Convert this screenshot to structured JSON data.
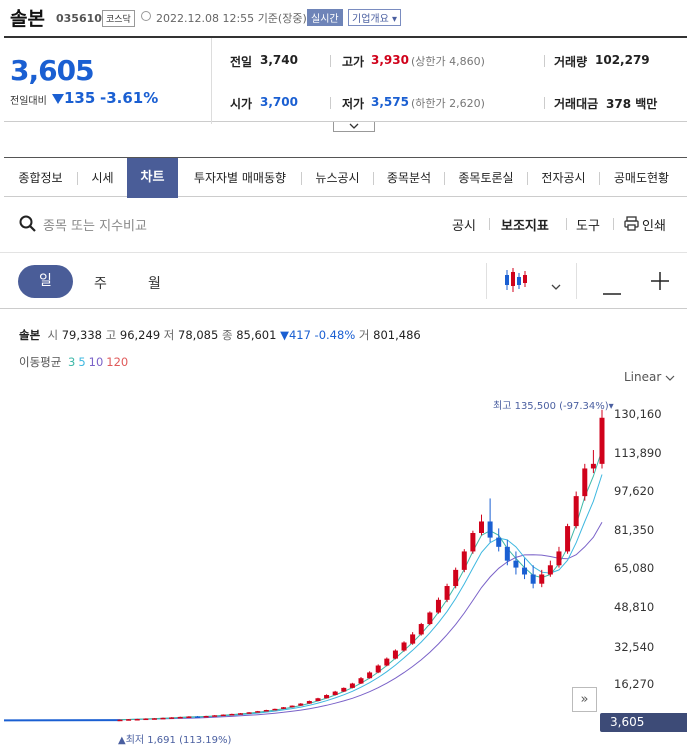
{
  "header": {
    "name": "솔본",
    "code": "035610",
    "market": "코스닥",
    "datetime": "2022.12.08 12:55",
    "basis": "기준(장중)",
    "realtime": "실시간",
    "company_info": "기업개요 ▾"
  },
  "summary": {
    "price": "3,605",
    "change_label": "전일대비",
    "change": "135",
    "change_pct": "-3.61%",
    "prev_close_label": "전일",
    "prev_close": "3,740",
    "high_label": "고가",
    "high": "3,930",
    "upper_limit": "(상한가 4,860)",
    "volume_label": "거래량",
    "volume": "102,279",
    "open_label": "시가",
    "open": "3,700",
    "low_label": "저가",
    "low": "3,575",
    "lower_limit": "(하한가 2,620)",
    "amount_label": "거래대금",
    "amount": "378 백만",
    "colors": {
      "up": "#d0021b",
      "down": "#1a5fd2"
    }
  },
  "tabs": [
    "종합정보",
    "시세",
    "차트",
    "투자자별 매매동향",
    "뉴스공시",
    "종목분석",
    "종목토론실",
    "전자공시",
    "공매도현황"
  ],
  "active_tab": "차트",
  "toolbar": {
    "search_placeholder": "종목 또는 지수비교",
    "disclosure": "공시",
    "indicators": "보조지표",
    "tools": "도구",
    "print": "인쇄"
  },
  "periods": {
    "day": "일",
    "week": "주",
    "month": "월",
    "active": "일"
  },
  "ohlc_bar": {
    "name": "솔본",
    "open_label": "시",
    "open": "79,338",
    "high_label": "고",
    "high": "96,249",
    "low_label": "저",
    "low": "78,085",
    "close_label": "종",
    "close": "85,601",
    "change": "▼417 -0.48%",
    "volume_label": "거",
    "volume": "801,486"
  },
  "ma_legend": {
    "label": "이동평균",
    "periods": [
      {
        "text": "3",
        "color": "#3fb8a8"
      },
      {
        "text": "5",
        "color": "#3fb8e0"
      },
      {
        "text": "10",
        "color": "#7a62c8"
      },
      {
        "text": "120",
        "color": "#e05a5a"
      }
    ]
  },
  "chart_data": {
    "type": "candlestick",
    "scale": "Linear",
    "y_ticks": [
      "130,160",
      "113,890",
      "97,620",
      "81,350",
      "65,080",
      "48,810",
      "32,540",
      "16,270"
    ],
    "ylim": [
      0,
      140000
    ],
    "high_marker": "최고 135,500 (-97.34%)▾",
    "low_marker": "▲최저 1,691 (113.19%)",
    "current": "3,605",
    "candles": [
      [
        800,
        1100,
        700,
        1000
      ],
      [
        1000,
        1300,
        900,
        1200
      ],
      [
        1200,
        1400,
        1100,
        1300
      ],
      [
        1300,
        1600,
        1200,
        1500
      ],
      [
        1500,
        1700,
        1400,
        1600
      ],
      [
        1600,
        1900,
        1500,
        1800
      ],
      [
        1800,
        2100,
        1700,
        2000
      ],
      [
        2000,
        2300,
        1900,
        2200
      ],
      [
        2200,
        2500,
        2100,
        2400
      ],
      [
        2400,
        2600,
        2200,
        2300
      ],
      [
        2300,
        2700,
        2200,
        2600
      ],
      [
        2600,
        3000,
        2500,
        2900
      ],
      [
        2900,
        3300,
        2800,
        3200
      ],
      [
        3200,
        3600,
        3100,
        3500
      ],
      [
        3500,
        3900,
        3400,
        3800
      ],
      [
        3800,
        4300,
        3700,
        4200
      ],
      [
        4200,
        4800,
        4100,
        4700
      ],
      [
        4700,
        5300,
        4600,
        5200
      ],
      [
        5200,
        5800,
        5100,
        5700
      ],
      [
        5700,
        6500,
        5600,
        6400
      ],
      [
        6400,
        7200,
        6300,
        7100
      ],
      [
        7100,
        8200,
        7000,
        8000
      ],
      [
        8000,
        9300,
        7900,
        9100
      ],
      [
        9100,
        10500,
        9000,
        10300
      ],
      [
        10300,
        12000,
        10200,
        11700
      ],
      [
        11700,
        13500,
        11500,
        13200
      ],
      [
        13200,
        15000,
        13000,
        14800
      ],
      [
        14800,
        17000,
        14600,
        16700
      ],
      [
        16700,
        19500,
        16500,
        19000
      ],
      [
        19000,
        22000,
        18800,
        21500
      ],
      [
        21500,
        25000,
        21200,
        24500
      ],
      [
        24500,
        28000,
        24200,
        27500
      ],
      [
        27500,
        31500,
        27200,
        31000
      ],
      [
        31000,
        35000,
        30500,
        34500
      ],
      [
        34000,
        39000,
        33500,
        38000
      ],
      [
        38000,
        43000,
        37500,
        42500
      ],
      [
        42500,
        48000,
        42000,
        47500
      ],
      [
        47500,
        54000,
        47000,
        53000
      ],
      [
        53000,
        60000,
        52000,
        59000
      ],
      [
        59000,
        67000,
        58000,
        66000
      ],
      [
        66000,
        75000,
        65000,
        74000
      ],
      [
        74000,
        83000,
        73000,
        82000
      ],
      [
        82000,
        90000,
        81000,
        87000
      ],
      [
        87000,
        97000,
        78000,
        80000
      ],
      [
        80000,
        84000,
        74000,
        76000
      ],
      [
        76000,
        79000,
        68000,
        70000
      ],
      [
        70000,
        74000,
        64000,
        67000
      ],
      [
        67000,
        71000,
        62000,
        64000
      ],
      [
        64000,
        68000,
        58000,
        60000
      ],
      [
        60000,
        66000,
        58500,
        64000
      ],
      [
        64000,
        70000,
        63000,
        68000
      ],
      [
        68000,
        76000,
        67000,
        74000
      ],
      [
        74000,
        86000,
        73000,
        85000
      ],
      [
        85000,
        100000,
        84000,
        98000
      ],
      [
        98000,
        112000,
        96000,
        110000
      ],
      [
        110000,
        118000,
        108000,
        112000
      ],
      [
        112000,
        135500,
        110000,
        132000
      ]
    ]
  }
}
